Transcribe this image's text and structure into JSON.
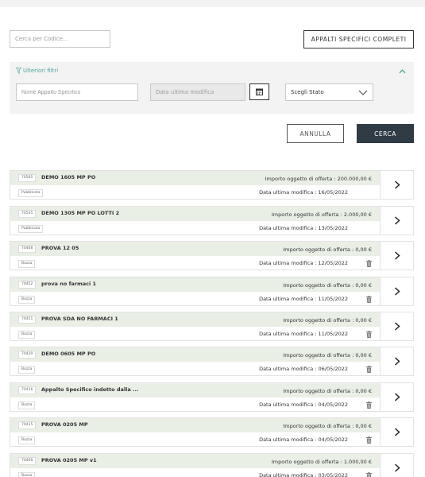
{
  "search": {
    "placeholder": "Cerca per Codice..."
  },
  "actions": {
    "complete_label": "APPALTI SPECIFICI COMPLETI",
    "cancel_label": "ANNULLA",
    "search_label": "CERCA"
  },
  "filters": {
    "title": "Ulteriori filtri",
    "name_placeholder": "Nome Appalto Specifico",
    "date_placeholder": "Data ultima modifica",
    "state_placeholder": "Scegli Stato"
  },
  "colors": {
    "accent": "#4aa39a",
    "dark_button": "#2f3b45",
    "card_header": "#eaefe6"
  },
  "items": [
    {
      "code": "70565",
      "title": "DEMO 1605 MP PO",
      "importo": "Importo oggetto di offerta : 200.000,00 €",
      "status": "Pubblicata",
      "date": "Data ultima modifica : 16/05/2022",
      "deletable": false
    },
    {
      "code": "70535",
      "title": "DEMO 1305 MP PO LOTTI 2",
      "importo": "Importo oggetto di offerta : 2.000,00 €",
      "status": "Pubblicata",
      "date": "Data ultima modifica : 13/05/2022",
      "deletable": false
    },
    {
      "code": "70468",
      "title": "PROVA 12 05",
      "importo": "Importo oggetto di offerta : 0,00 €",
      "status": "Bozza",
      "date": "Data ultima modifica : 12/05/2022",
      "deletable": true
    },
    {
      "code": "70452",
      "title": "prova no farmaci 1",
      "importo": "Importo oggetto di offerta : 0,00 €",
      "status": "Bozza",
      "date": "Data ultima modifica : 11/05/2022",
      "deletable": true
    },
    {
      "code": "70451",
      "title": "PROVA SDA NO FARMACI 1",
      "importo": "Importo oggetto di offerta : 0,00 €",
      "status": "Bozza",
      "date": "Data ultima modifica : 11/05/2022",
      "deletable": true
    },
    {
      "code": "70429",
      "title": "DEMO 0605 MP PO",
      "importo": "Importo oggetto di offerta : 0,00 €",
      "status": "Bozza",
      "date": "Data ultima modifica : 06/05/2022",
      "deletable": true
    },
    {
      "code": "70416",
      "title": "Appalto Specifico indetto dalla ...",
      "importo": "Importo oggetto di offerta : 0,00 €",
      "status": "Bozza",
      "date": "Data ultima modifica : 04/05/2022",
      "deletable": true
    },
    {
      "code": "70415",
      "title": "PROVA 0205 MP",
      "importo": "Importo oggetto di offerta : 0,00 €",
      "status": "Bozza",
      "date": "Data ultima modifica : 04/05/2022",
      "deletable": true
    },
    {
      "code": "70409",
      "title": "PROVA 0205 MP v1",
      "importo": "Importo oggetto di offerta : 1.000,00 €",
      "status": "Bozza",
      "date": "Data ultima modifica : 03/05/2022",
      "deletable": true
    }
  ]
}
